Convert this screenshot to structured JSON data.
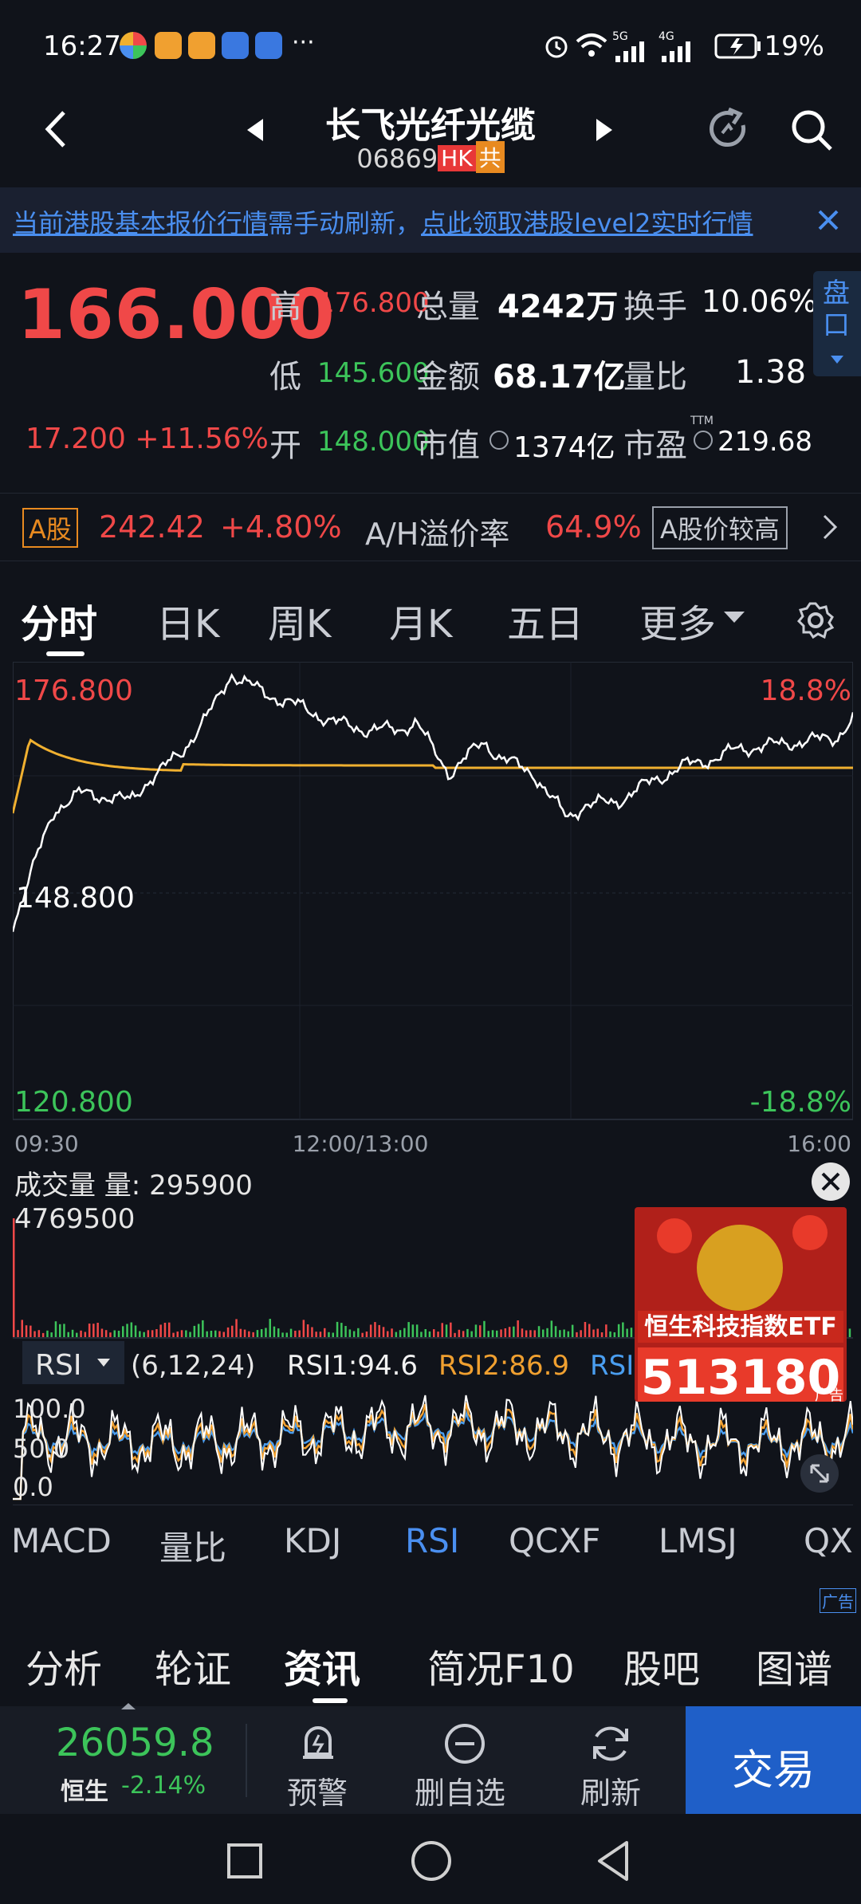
{
  "status": {
    "time": "16:27",
    "network": "5G",
    "network2": "4G",
    "battery": "19%"
  },
  "header": {
    "name": "长飞光纤光缆",
    "code": "06869",
    "market_tag": "HK",
    "gong_tag": "共"
  },
  "notice": {
    "text_a": "当前港股基本报价行情",
    "text_b": "需手动刷新，",
    "text_c": "点此领取港股level2实时行情"
  },
  "quote": {
    "price": "166.000",
    "change_abs": "17.200",
    "change_pct": "+11.56%",
    "high_label": "高",
    "high": "176.800",
    "low_label": "低",
    "low": "145.600",
    "open_label": "开",
    "open": "148.000",
    "vol_label": "总量",
    "vol": "4242万",
    "amt_label": "金额",
    "amt": "68.17亿",
    "mcap_label": "市值",
    "mcap": "1374亿",
    "turn_label": "换手",
    "turn": "10.06%",
    "vr_label": "量比",
    "vr": "1.38",
    "pe_label": "市盈",
    "pe_sup": "TTM",
    "pe": "219.68",
    "panel_btn": "盘口"
  },
  "ashare": {
    "tag": "A股",
    "price": "242.42",
    "pct": "+4.80%",
    "premium_label": "A/H溢价率",
    "premium": "64.9%",
    "note": "A股价较高"
  },
  "chart_tabs": [
    "分时",
    "日K",
    "周K",
    "月K",
    "五日",
    "更多"
  ],
  "chart": {
    "y_top": "176.800",
    "y_mid": "148.800",
    "y_bottom": "120.800",
    "pct_top": "18.8%",
    "pct_bottom": "-18.8%",
    "t_start": "09:30",
    "t_mid": "12:00/13:00",
    "t_end": "16:00",
    "vol_title": "成交量 量: 295900",
    "vol_max": "4769500",
    "rsi_title": "RSI",
    "rsi_params": "(6,12,24)",
    "rsi1": "RSI1:94.6",
    "rsi2": "RSI2:86.9",
    "rsi3": "RSI",
    "rsi_100": "100.0",
    "rsi_50": "50.0",
    "rsi_0": "0.0",
    "ad_title": "恒生科技指数ETF",
    "ad_code": "513180",
    "ad_label": "广告"
  },
  "indicator_tabs": [
    "MACD",
    "量比",
    "KDJ",
    "RSI",
    "QCXF",
    "LMSJ",
    "QX"
  ],
  "ad_strip_label": "广告",
  "bottom_tabs": [
    "分析",
    "轮证",
    "资讯",
    "简况F10",
    "股吧",
    "图谱"
  ],
  "toolbar": {
    "index_value": "26059.8",
    "index_name": "恒生",
    "index_pct": "-2.14%",
    "alert": "预警",
    "remove": "删自选",
    "refresh": "刷新",
    "trade": "交易"
  },
  "colors": {
    "up": "#f04848",
    "down": "#3cc45a",
    "avg_line": "#f0b030",
    "price_line": "#ffffff",
    "accent": "#1f5fc8"
  }
}
